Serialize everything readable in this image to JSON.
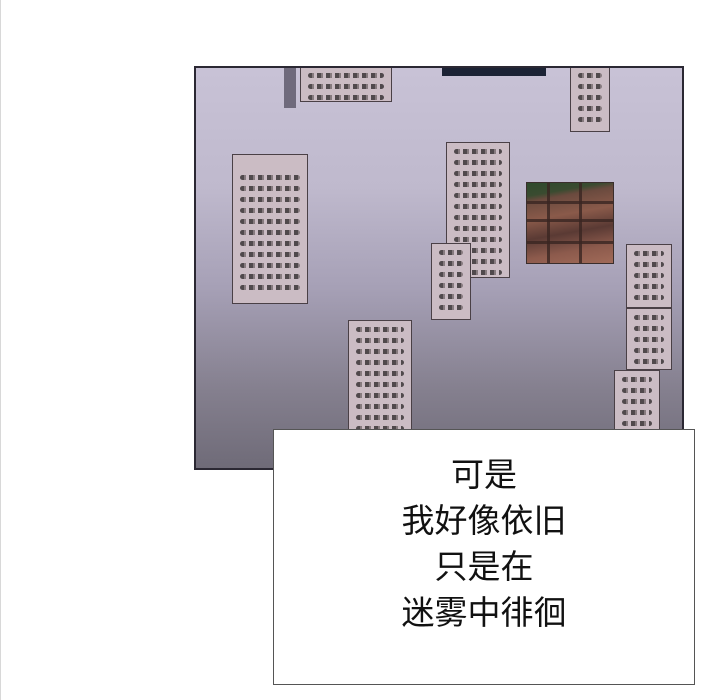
{
  "caption": {
    "lines": [
      "可是",
      "我好像依旧",
      "只是在",
      "迷雾中徘徊"
    ]
  },
  "icons": {
    "papers": "blurred-note-icon",
    "photo": "warehouse-photo-icon"
  },
  "colors": {
    "wall_top": "#c8c2d6",
    "wall_bottom": "#6f6b78",
    "paper": "#cbbcc4",
    "caption_border": "#555555"
  }
}
